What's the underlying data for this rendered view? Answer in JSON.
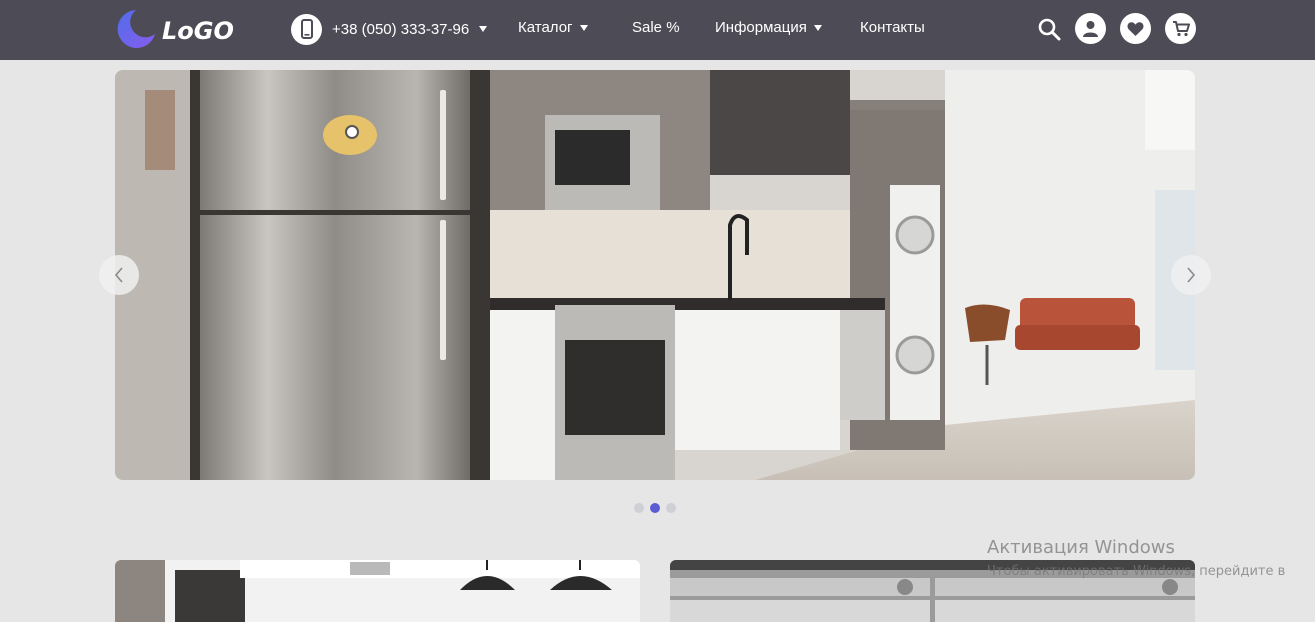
{
  "header": {
    "logo_text": "LoGO",
    "phone": "+38 (050) 333-37-96",
    "nav": [
      {
        "label": "Каталог"
      },
      {
        "label": "Sale %"
      },
      {
        "label": "Информация"
      },
      {
        "label": "Контакты"
      }
    ],
    "icons": [
      "phone-icon",
      "search-icon",
      "user-icon",
      "heart-icon",
      "cart-icon"
    ]
  },
  "slider": {
    "image": "kitchen-with-stainless-fridge",
    "slide_count": 3,
    "active_slide": 2,
    "prev_icon": "chevron-left-icon",
    "next_icon": "chevron-right-icon"
  },
  "tiles": [
    {
      "image": "kitchen-with-pendant-lamps"
    },
    {
      "image": "appliance-store-shelves"
    }
  ],
  "watermark": {
    "title": "Активация Windows",
    "subtitle": "Чтобы активировать Windows, перейдите в"
  },
  "colors": {
    "header_bg": "#4d4c56",
    "page_bg": "#e6e6e6",
    "accent": "#5b5bd4",
    "logo_moon": "#7b6cf0"
  }
}
